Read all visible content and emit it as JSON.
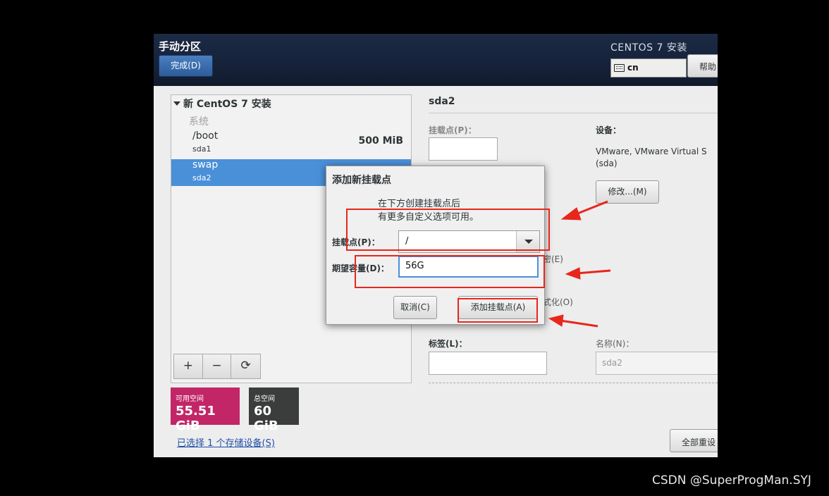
{
  "header": {
    "title": "手动分区",
    "done_button": "完成(D)",
    "product": "CENTOS 7 安装",
    "keyboard_layout": "cn",
    "help_button": "帮助"
  },
  "tree": {
    "root": "新 CentOS 7 安装",
    "group": "系统",
    "rows": [
      {
        "name": "/boot",
        "device": "sda1",
        "size": "500 MiB"
      },
      {
        "name": "swap",
        "device": "sda2",
        "size": ""
      }
    ],
    "toolbar": {
      "add": "+",
      "remove": "−",
      "refresh": "⟳"
    }
  },
  "space": {
    "available_label": "可用空间",
    "available_value": "55.51 GiB",
    "total_label": "总空间",
    "total_value": "60 GiB"
  },
  "storage_link": "已选择 1 个存储设备(S)",
  "details": {
    "title": "sda2",
    "mount_label": "挂载点(P)：",
    "device_label": "设备：",
    "device_value": "VMware, VMware Virtual S (sda)",
    "modify_button": "修改...(M)",
    "encrypt_fragment": "密(E)",
    "format_fragment": "式化(O)",
    "label_label": "标签(L)：",
    "name_label": "名称(N)：",
    "name_value": "sda2",
    "reset_button": "全部重设"
  },
  "dialog": {
    "title": "添加新挂载点",
    "desc_line1": "在下方创建挂载点后",
    "desc_line2": "有更多自定义选项可用。",
    "mount_label": "挂载点(P)：",
    "mount_value": "/",
    "size_label": "期望容量(D)：",
    "size_value": "56G",
    "cancel_button": "取消(C)",
    "add_button": "添加挂载点(A)"
  },
  "annotation_color": "#e8261c",
  "watermark": "CSDN @SuperProgMan.SYJ"
}
